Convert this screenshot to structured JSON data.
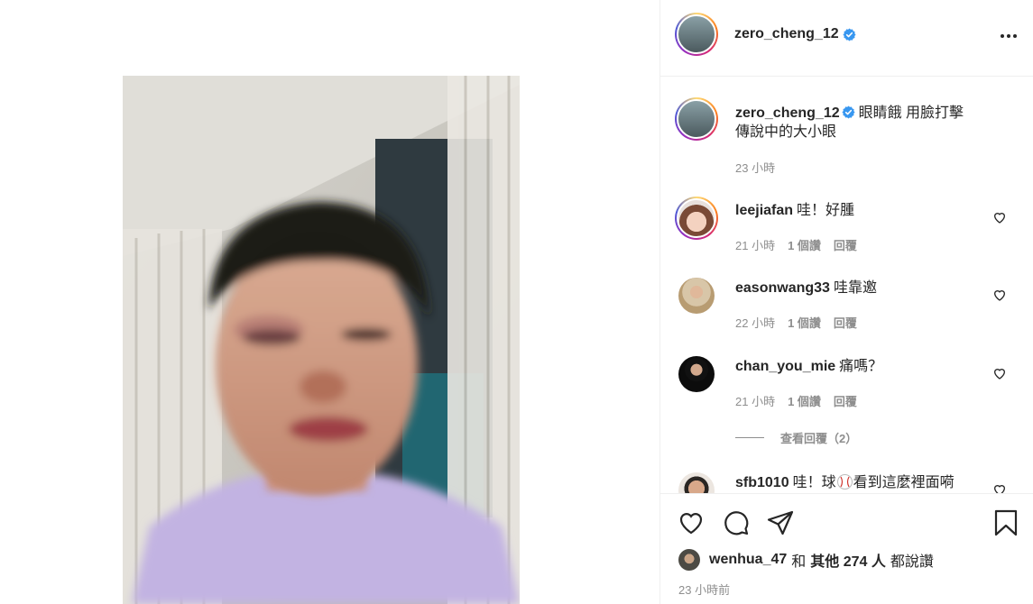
{
  "post": {
    "author": "zero_cheng_12",
    "caption_line1": "眼睛餓 用臉打擊",
    "caption_line2": "傳說中的大小眼",
    "caption_time": "23 小時"
  },
  "comments": [
    {
      "user": "leejiafan",
      "text": "哇！好腫",
      "time": "21 小時",
      "likes": "1 個讚",
      "reply": "回覆"
    },
    {
      "user": "easonwang33",
      "text": "哇靠邀",
      "time": "22 小時",
      "likes": "1 個讚",
      "reply": "回覆"
    },
    {
      "user": "chan_you_mie",
      "text": "痛嗎？",
      "time": "21 小時",
      "likes": "1 個讚",
      "reply": "回覆"
    },
    {
      "user": "sfb1010",
      "text_before": "哇！球",
      "text_after": "看到這麼裡面嗬"
    }
  ],
  "view_replies": "查看回覆（2）",
  "likes": {
    "user": "wenhua_47",
    "and": "和",
    "others_prefix": "其他",
    "count": "274 人",
    "suffix": "都說讚"
  },
  "posted": "23 小時前",
  "colors": {
    "verified": "#3897f0",
    "muted": "#8e8e8e",
    "text": "#262626",
    "border": "#efefef"
  },
  "icons": [
    "verified-badge-icon",
    "more-options-icon",
    "heart-icon",
    "comment-icon",
    "share-icon",
    "bookmark-icon",
    "baseball-emoji-icon"
  ]
}
